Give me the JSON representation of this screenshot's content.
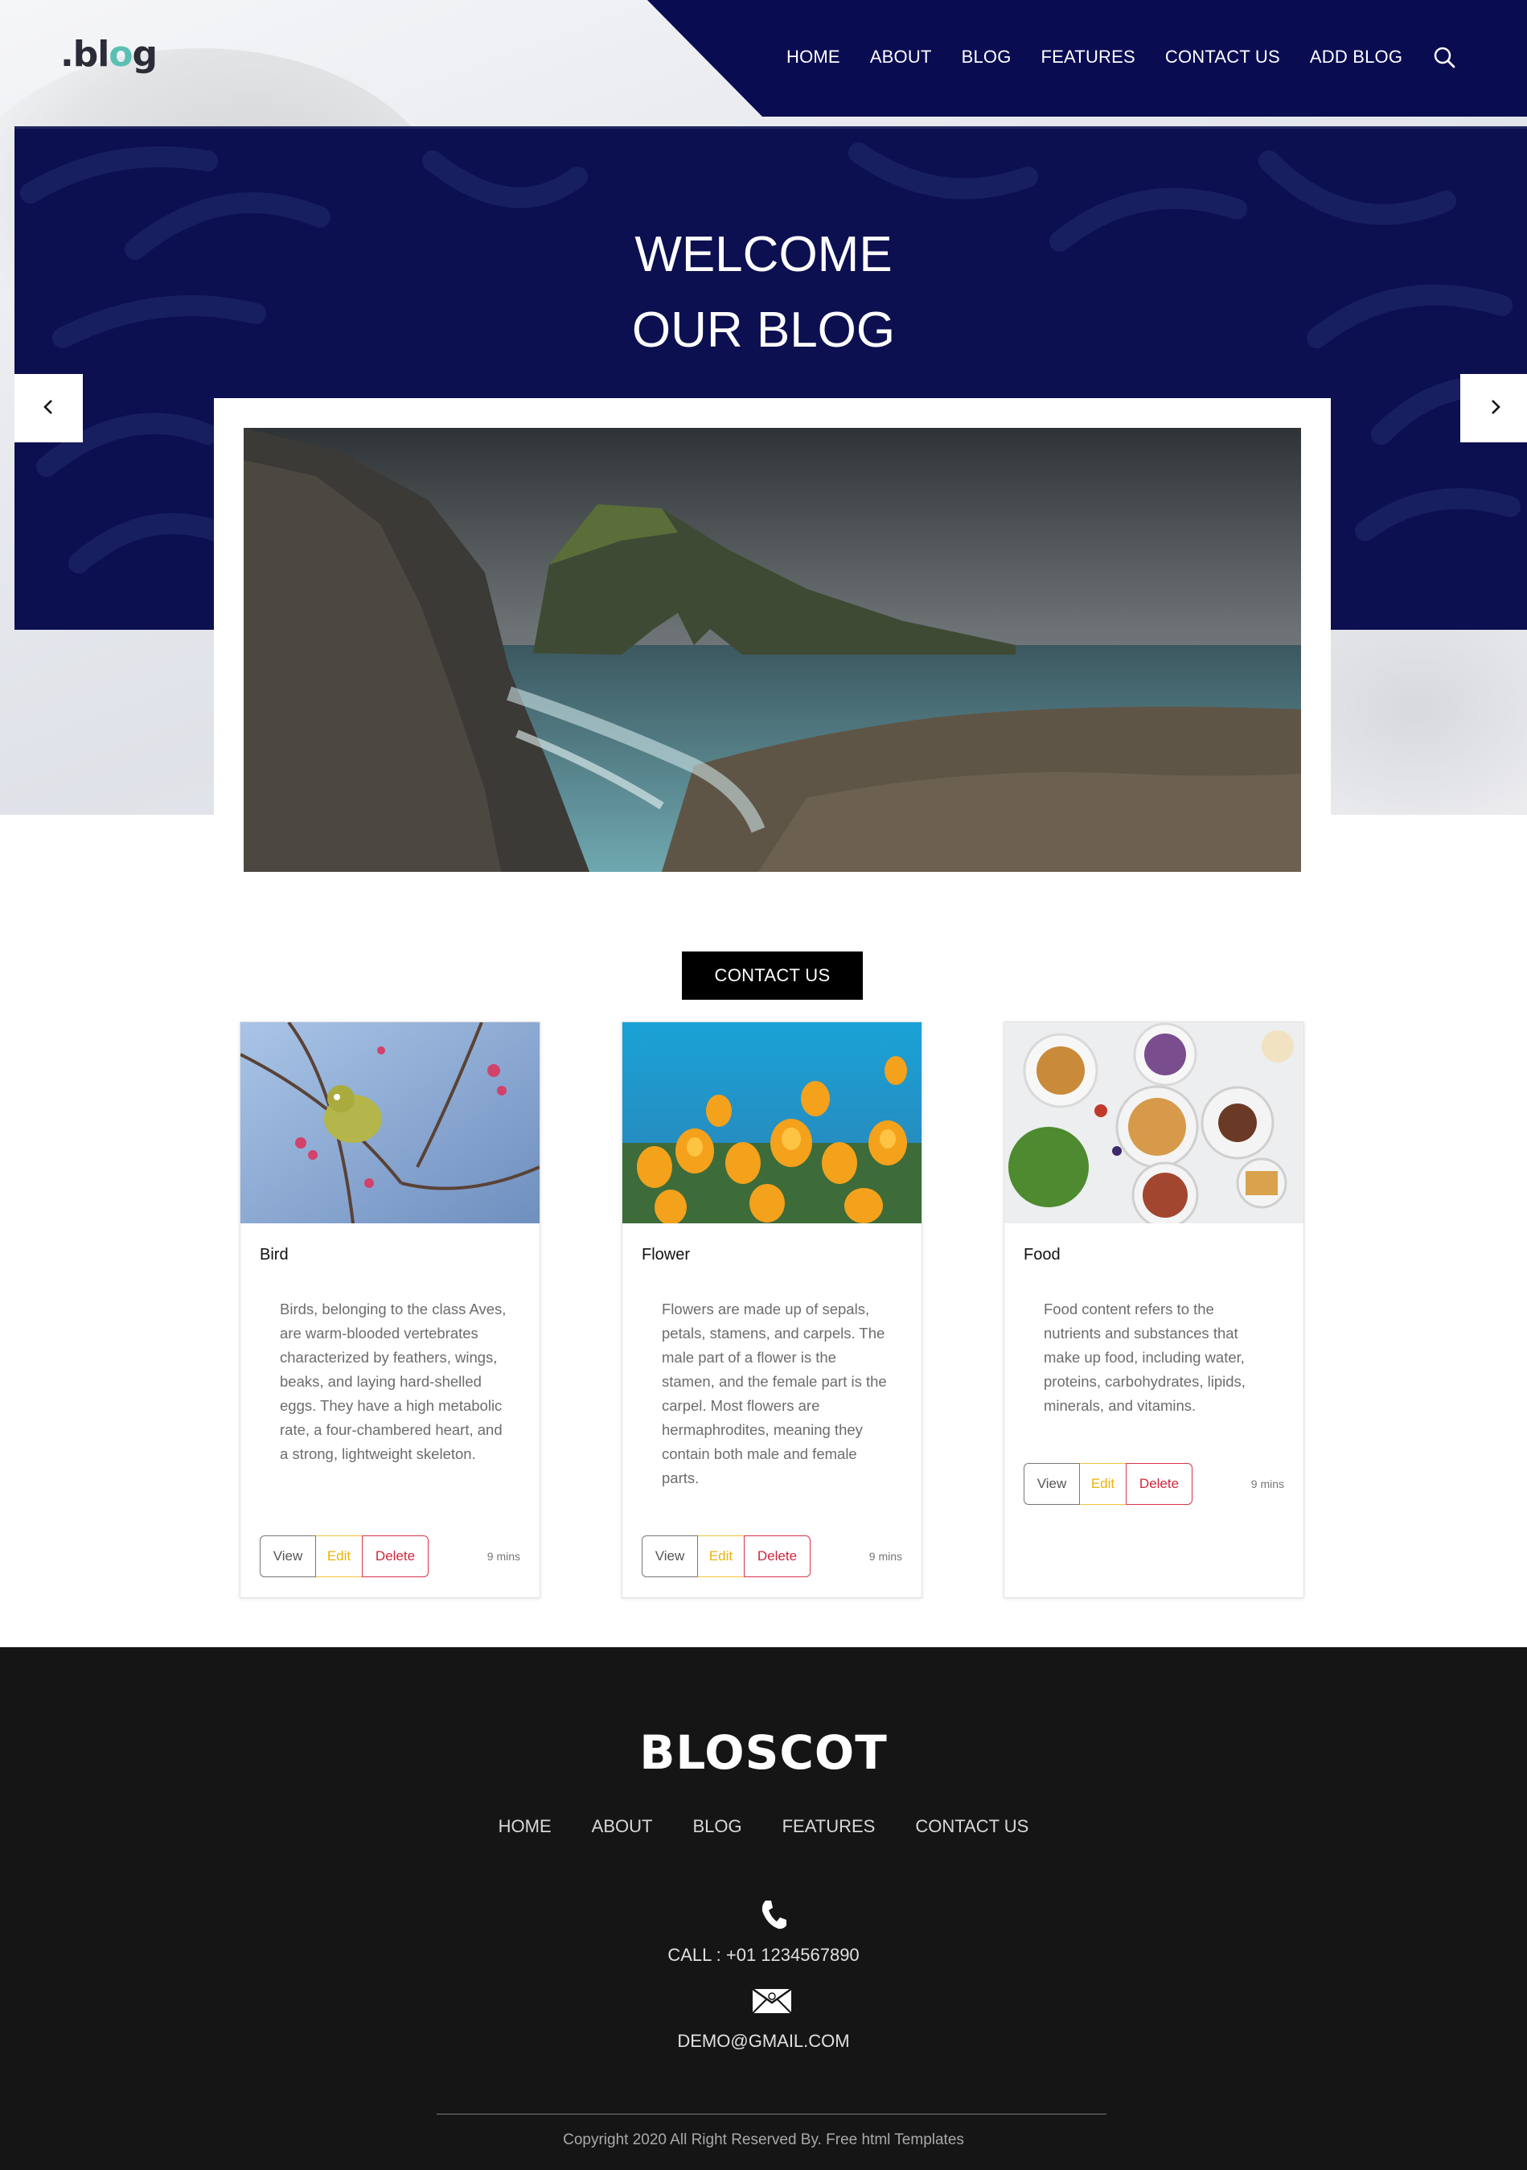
{
  "header": {
    "logo_text": ".bl",
    "logo_accent": "o",
    "logo_tail": "g",
    "nav": [
      {
        "label": "HOME"
      },
      {
        "label": "ABOUT"
      },
      {
        "label": "BLOG"
      },
      {
        "label": "FEATURES"
      },
      {
        "label": "CONTACT US"
      },
      {
        "label": "ADD BLOG"
      }
    ],
    "search_icon": "search-icon"
  },
  "hero": {
    "title_line1": "WELCOME",
    "title_line2": "OUR BLOG",
    "prev_icon": "chevron-left-icon",
    "next_icon": "chevron-right-icon",
    "image": "coastal-rock-arch-photo"
  },
  "contact_button": "CONTACT US",
  "cards": [
    {
      "title": "Bird",
      "image": "bird-photo",
      "body": "Birds, belonging to the class Aves, are warm-blooded vertebrates characterized by feathers, wings, beaks, and laying hard-shelled eggs. They have a high metabolic rate, a four-chambered heart, and a strong, lightweight skeleton.",
      "view": "View",
      "edit": "Edit",
      "delete": "Delete",
      "mins": "9 mins"
    },
    {
      "title": "Flower",
      "image": "flower-photo",
      "body": "Flowers are made up of sepals, petals, stamens, and carpels. The male part of a flower is the stamen, and the female part is the carpel. Most flowers are hermaphrodites, meaning they contain both male and female parts.",
      "view": "View",
      "edit": "Edit",
      "delete": "Delete",
      "mins": "9 mins"
    },
    {
      "title": "Food",
      "image": "food-photo",
      "body": "Food content refers to the nutrients and substances that make up food, including water, proteins, carbohydrates, lipids, minerals, and vitamins.",
      "view": "View",
      "edit": "Edit",
      "delete": "Delete",
      "mins": "9 mins"
    }
  ],
  "footer": {
    "brand": "BLOSCOT",
    "nav": [
      {
        "label": "HOME"
      },
      {
        "label": "ABOUT"
      },
      {
        "label": "BLOG"
      },
      {
        "label": "FEATURES"
      },
      {
        "label": "CONTACT US"
      }
    ],
    "phone_icon": "phone-icon",
    "call": "CALL : +01 1234567890",
    "mail_icon": "mail-icon",
    "email": "DEMO@GMAIL.COM",
    "copyright": "Copyright 2020 All Right Reserved By. Free html Templates"
  },
  "colors": {
    "nav_band": "#0a0c52",
    "banner": "#0c1050",
    "footer": "#151515",
    "edit": "#eab308",
    "delete": "#d0263c",
    "logo_accent": "#59c0b4"
  }
}
